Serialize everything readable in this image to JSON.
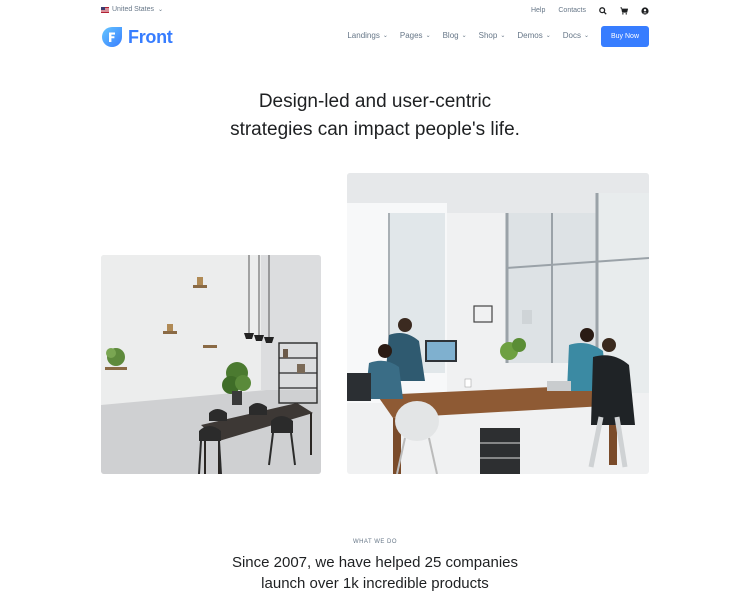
{
  "topbar": {
    "locale": "United States",
    "links": [
      "Help",
      "Contacts"
    ],
    "icons": [
      "search-icon",
      "cart-icon",
      "user-icon"
    ]
  },
  "header": {
    "logo_letter": "F",
    "logo_text": "Front",
    "nav": [
      "Landings",
      "Pages",
      "Blog",
      "Shop",
      "Demos",
      "Docs"
    ],
    "buy_label": "Buy Now"
  },
  "hero": {
    "line1": "Design-led and user-centric",
    "line2": "strategies can impact people's life."
  },
  "section": {
    "eyebrow": "WHAT WE DO",
    "line1": "Since 2007, we have helped 25 companies",
    "line2": "launch over 1k incredible products"
  },
  "colors": {
    "primary": "#377dff",
    "text": "#1e2022",
    "muted": "#677788"
  }
}
